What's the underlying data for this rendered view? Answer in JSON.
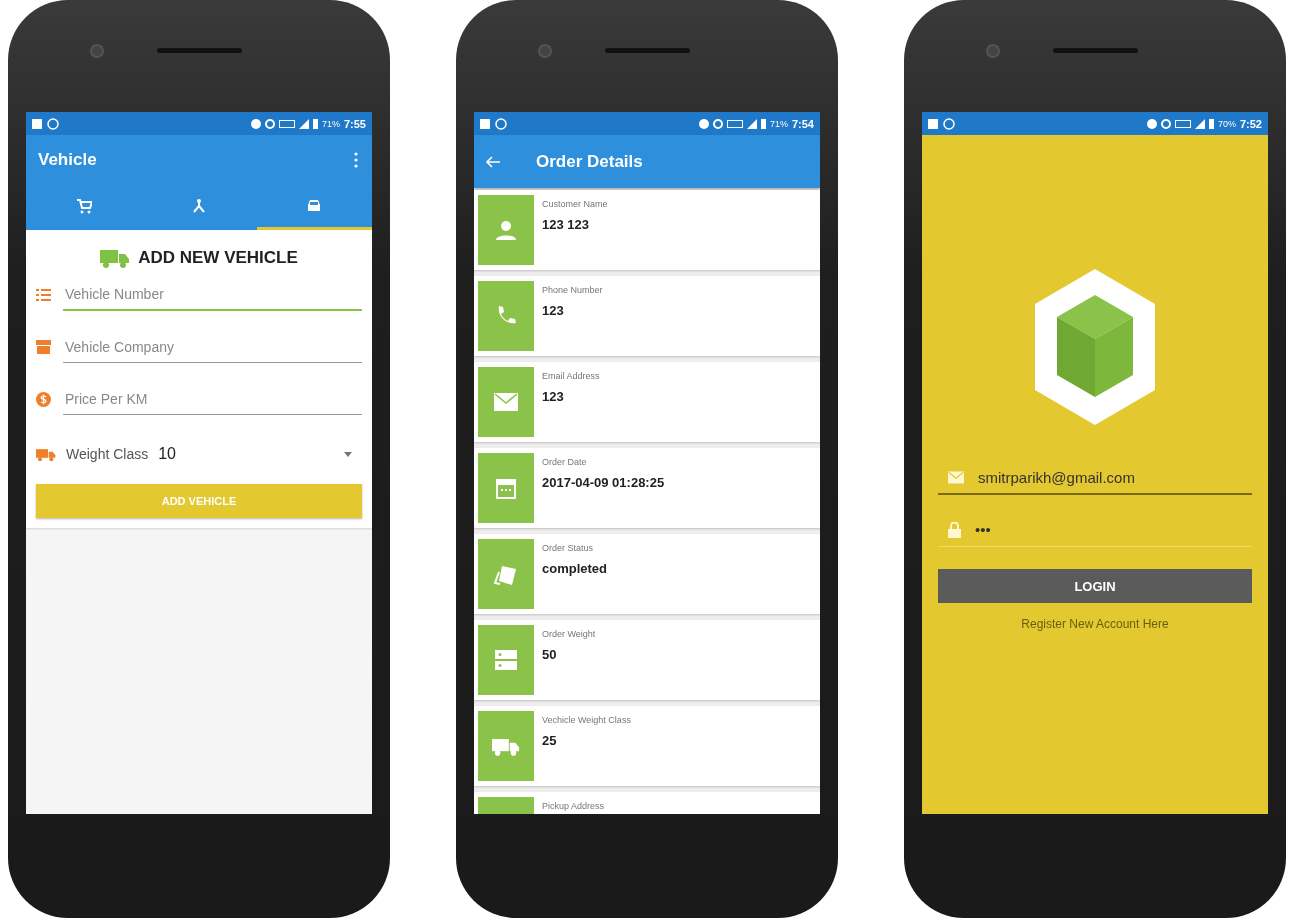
{
  "vehicle_screen": {
    "status_bar": {
      "battery": "71%",
      "time": "7:55"
    },
    "app_bar": {
      "title": "Vehicle"
    },
    "tabs": [
      {
        "selected": false
      },
      {
        "selected": false
      },
      {
        "selected": true
      }
    ],
    "heading": "ADD NEW VEHICLE",
    "fields": [
      {
        "placeholder": "Vehicle Number",
        "focused": true
      },
      {
        "placeholder": "Vehicle Company",
        "focused": false
      },
      {
        "placeholder": "Price Per KM",
        "focused": false
      }
    ],
    "weight_class": {
      "label": "Weight Class",
      "value": "10"
    },
    "button": "ADD VEHICLE"
  },
  "order_details_screen": {
    "status_bar": {
      "battery": "71%",
      "time": "7:54"
    },
    "app_bar": {
      "title": "Order Details"
    },
    "items": [
      {
        "label": "Customer Name",
        "value": "123 123"
      },
      {
        "label": "Phone Number",
        "value": "123"
      },
      {
        "label": "Email Address",
        "value": "123"
      },
      {
        "label": "Order Date",
        "value": "2017-04-09 01:28:25"
      },
      {
        "label": "Order Status",
        "value": "completed"
      },
      {
        "label": "Order Weight",
        "value": "50"
      },
      {
        "label": "Vechicle Weight Class",
        "value": "25"
      },
      {
        "label": "Pickup Address"
      }
    ]
  },
  "login_screen": {
    "status_bar": {
      "battery": "70%",
      "time": "7:52"
    },
    "email": {
      "value": "smitrparikh@gmail.com",
      "focused": true
    },
    "password": {
      "value": "•••",
      "focused": false
    },
    "button": "LOGIN",
    "link": "Register New Account Here"
  }
}
